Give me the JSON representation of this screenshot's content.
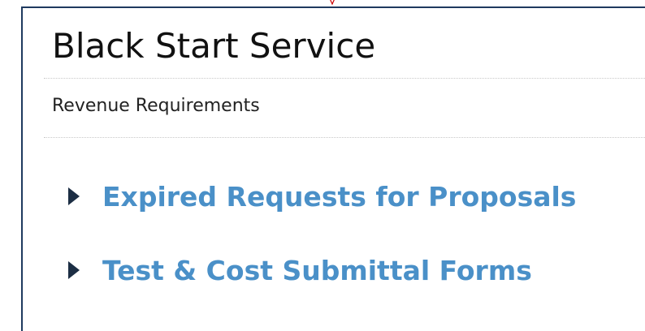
{
  "header": {
    "title": "Black Start Service",
    "subtitle": "Revenue Requirements"
  },
  "links": [
    {
      "label": "Expired Requests for Proposals",
      "icon": "caret-right-icon"
    },
    {
      "label": "Test & Cost Submittal Forms",
      "icon": "caret-right-icon"
    }
  ],
  "colors": {
    "link": "#4a90c8",
    "arrow": "#1c2e44",
    "frame": "#1f3a5f",
    "marker": "#cc0000"
  }
}
